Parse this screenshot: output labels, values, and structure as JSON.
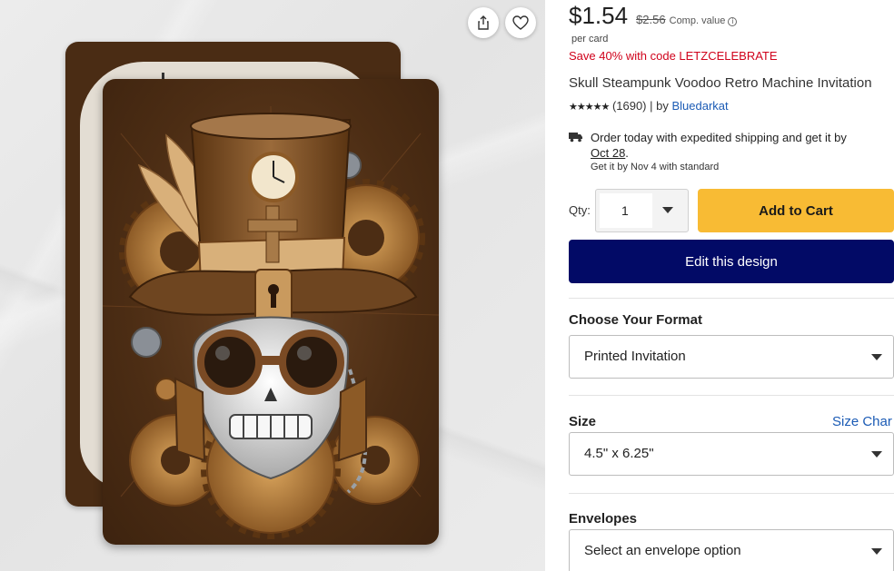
{
  "product": {
    "price": "$1.54",
    "original_price": "$2.56",
    "comp_value_label": "Comp. value",
    "per_card": "per card",
    "promo": "Save 40% with code LETZCELEBRATE",
    "title": "Skull Steampunk Voodoo Retro Machine Invitation",
    "stars": "★★★★★",
    "rating_value": 5,
    "review_count": "(1690)",
    "by_label": "| by",
    "author": "Bluedarkat"
  },
  "shipping": {
    "text": "Order today with expedited shipping and get it by",
    "date": "Oct 28",
    "punct": ".",
    "standard": "Get it by Nov 4 with standard"
  },
  "purchase": {
    "qty_label": "Qty:",
    "qty_value": "1",
    "add_to_cart": "Add to Cart",
    "edit_design": "Edit this design"
  },
  "options": {
    "format_label": "Choose Your Format",
    "format_value": "Printed Invitation",
    "size_label": "Size",
    "size_chart": "Size Char",
    "size_value": "4.5\" x 6.25\"",
    "envelopes_label": "Envelopes",
    "envelopes_value": "Select an envelope option"
  },
  "icons": {
    "share": "share-icon",
    "favorite": "heart-icon",
    "shipping": "truck-icon",
    "info": "info-icon"
  },
  "colors": {
    "promo": "#d0021b",
    "add_to_cart": "#f8bb34",
    "edit_design": "#020a66",
    "link": "#1b5bb5"
  }
}
